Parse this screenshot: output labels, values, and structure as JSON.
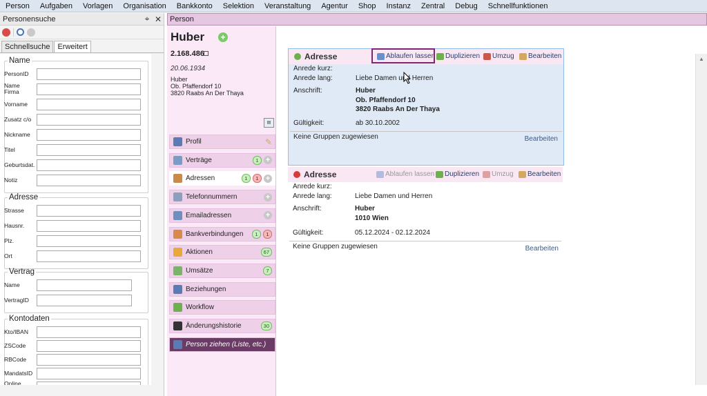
{
  "menu": [
    "Person",
    "Aufgaben",
    "Vorlagen",
    "Organisation",
    "Bankkonto",
    "Selektion",
    "Veranstaltung",
    "Agentur",
    "Shop",
    "Instanz",
    "Zentral",
    "Debug",
    "Schnellfunktionen"
  ],
  "left": {
    "title": "Personensuche",
    "pin_glyph": "⌖",
    "close_glyph": "✕",
    "tabs": [
      "Schnellsuche",
      "Erweitert"
    ],
    "groups": {
      "name": {
        "legend": "Name",
        "fields": [
          "PersonID",
          "Name\nFirma",
          "Vorname",
          "Zusatz c/o",
          "Nickname",
          "Titel",
          "Geburtsdat.",
          "Notiz"
        ]
      },
      "adresse": {
        "legend": "Adresse",
        "fields": [
          "Strasse",
          "Hausnr.",
          "Plz.",
          "Ort"
        ]
      },
      "vertrag": {
        "legend": "Vertrag",
        "fields": [
          "Name",
          "VertragID"
        ]
      },
      "kontodaten": {
        "legend": "Kontodaten",
        "fields": [
          "Kto/IBAN",
          "ZSCode",
          "RBCode",
          "MandatsID",
          "Online\nReferenz"
        ]
      }
    }
  },
  "person_tab": "Person",
  "person": {
    "name": "Huber",
    "id": "2.168.486",
    "dob": "20.06.1934",
    "address_lines": [
      "Huber",
      "Ob. Pfaffendorf 10",
      "3820 Raabs An Der Thaya"
    ]
  },
  "nav": [
    {
      "label": "Profil",
      "icon": "person-icon",
      "color": "#5a7bb5",
      "badges": [],
      "action": "pencil"
    },
    {
      "label": "Verträge",
      "icon": "contract-icon",
      "color": "#7a9cc4",
      "badges": [
        {
          "t": "1",
          "c": "g"
        }
      ],
      "action": "plus"
    },
    {
      "label": "Adressen",
      "icon": "house-icon",
      "color": "#c98a4a",
      "badges": [
        {
          "t": "1",
          "c": "g"
        },
        {
          "t": "1",
          "c": "r"
        }
      ],
      "action": "plus"
    },
    {
      "label": "Telefonnummern",
      "icon": "phone-icon",
      "color": "#8aa0bf",
      "badges": [],
      "action": "plus"
    },
    {
      "label": "Emailadressen",
      "icon": "mail-icon",
      "color": "#6f8fbf",
      "badges": [],
      "action": "plus"
    },
    {
      "label": "Bankverbindungen",
      "icon": "bank-icon",
      "color": "#d98a4a",
      "badges": [
        {
          "t": "1",
          "c": "g"
        },
        {
          "t": "1",
          "c": "r"
        }
      ],
      "action": ""
    },
    {
      "label": "Aktionen",
      "icon": "lightning-icon",
      "color": "#e6a93a",
      "badges": [
        {
          "t": "67",
          "c": "g"
        }
      ],
      "action": ""
    },
    {
      "label": "Umsätze",
      "icon": "money-icon",
      "color": "#7bb36a",
      "badges": [
        {
          "t": "7",
          "c": "g"
        }
      ],
      "action": ""
    },
    {
      "label": "Beziehungen",
      "icon": "people-icon",
      "color": "#5a7bb5",
      "badges": [],
      "action": ""
    },
    {
      "label": "Workflow",
      "icon": "workflow-icon",
      "color": "#6fb04e",
      "badges": [],
      "action": ""
    },
    {
      "label": "Änderungshistorie",
      "icon": "history-icon",
      "color": "#333333",
      "badges": [
        {
          "t": "30",
          "c": "g"
        }
      ],
      "action": ""
    },
    {
      "label": "Person ziehen (Liste, etc.)",
      "icon": "person-pull-icon",
      "color": "#5a7bb5",
      "badges": [],
      "action": ""
    }
  ],
  "cards": [
    {
      "title": "Adresse",
      "status_color": "#6fb04e",
      "actions": {
        "expire": "Ablaufen lassen",
        "duplicate": "Duplizieren",
        "move": "Umzug",
        "edit": "Bearbeiten"
      },
      "labels": {
        "short": "Anrede kurz:",
        "long": "Anrede lang:",
        "address": "Anschrift:",
        "valid": "Gültigkeit:"
      },
      "anrede_kurz": "",
      "anrede_lang": "Liebe Damen und Herren",
      "anschrift": [
        "Huber",
        "Ob. Pfaffendorf 10",
        "3820 Raabs An Der Thaya"
      ],
      "gueltigkeit": "ab 30.10.2002",
      "groups": "Keine Gruppen zugewiesen",
      "groups_edit": "Bearbeiten"
    },
    {
      "title": "Adresse",
      "status_color": "#d93a3a",
      "actions": {
        "expire": "Ablaufen lassen",
        "duplicate": "Duplizieren",
        "move": "Umzug",
        "edit": "Bearbeiten"
      },
      "labels": {
        "short": "Anrede kurz:",
        "long": "Anrede lang:",
        "address": "Anschrift:",
        "valid": "Gültigkeit:"
      },
      "anrede_kurz": "",
      "anrede_lang": "Liebe Damen und Herren",
      "anschrift": [
        "Huber",
        "1010 Wien"
      ],
      "gueltigkeit": "05.12.2024 - 02.12.2024",
      "groups": "Keine Gruppen zugewiesen",
      "groups_edit": "Bearbeiten"
    }
  ]
}
